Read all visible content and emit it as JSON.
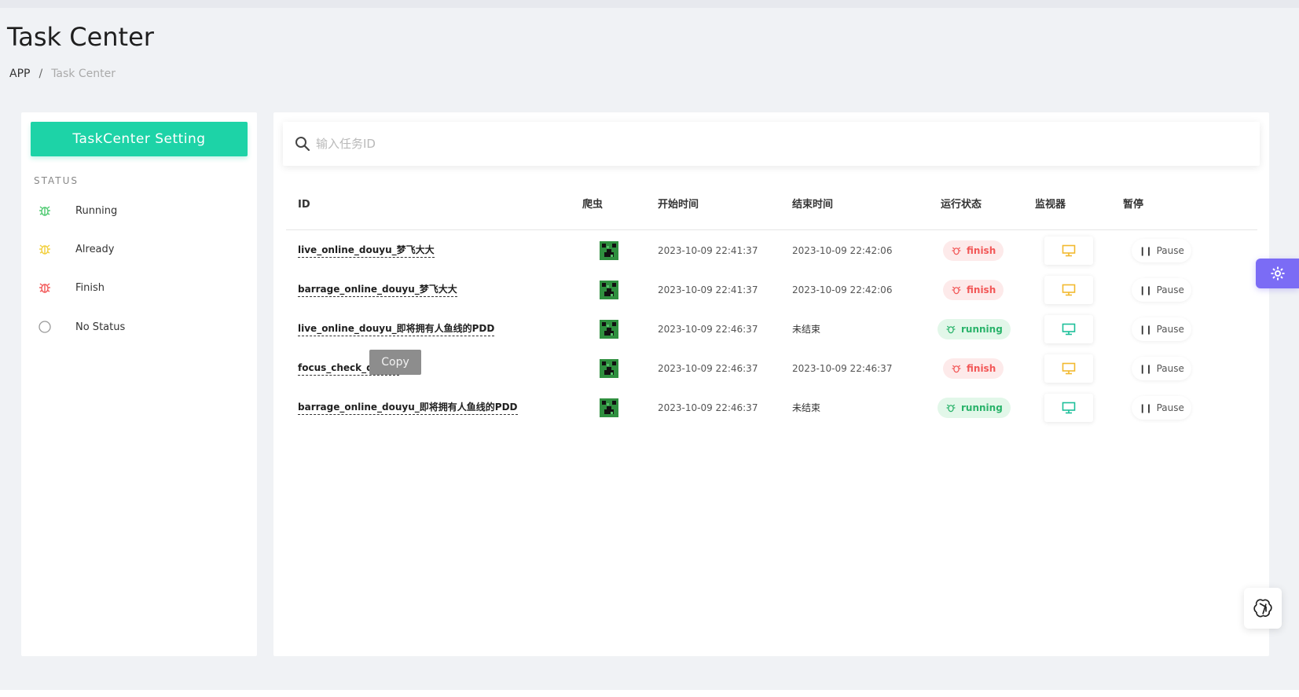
{
  "page": {
    "title": "Task Center",
    "breadcrumb": {
      "root": "APP",
      "separator": "/",
      "current": "Task Center"
    }
  },
  "sidebar": {
    "setting_button": "TaskCenter Setting",
    "status_heading": "STATUS",
    "items": [
      {
        "label": "Running",
        "icon": "bug-icon",
        "color": "#4cc96f"
      },
      {
        "label": "Already",
        "icon": "bug-icon",
        "color": "#f2cf3b"
      },
      {
        "label": "Finish",
        "icon": "bug-icon",
        "color": "#f25757"
      },
      {
        "label": "No Status",
        "icon": "circle-icon",
        "color": "#999999"
      }
    ]
  },
  "search": {
    "placeholder": "输入任务ID",
    "value": ""
  },
  "table": {
    "columns": [
      "ID",
      "爬虫",
      "开始时间",
      "结束时间",
      "运行状态",
      "监视器",
      "暂停"
    ],
    "rows": [
      {
        "id": "live_online_douyu_梦飞大大",
        "start": "2023-10-09 22:41:37",
        "end": "2023-10-09 22:42:06",
        "status": "finish",
        "monitor_color": "#f2b92e",
        "pause": "Pause"
      },
      {
        "id": "barrage_online_douyu_梦飞大大",
        "start": "2023-10-09 22:41:37",
        "end": "2023-10-09 22:42:06",
        "status": "finish",
        "monitor_color": "#f2b92e",
        "pause": "Pause"
      },
      {
        "id": "live_online_douyu_即将拥有人鱼线的PDD",
        "start": "2023-10-09 22:46:37",
        "end": "未结束",
        "status": "running",
        "monitor_color": "#1dbf9a",
        "pause": "Pause"
      },
      {
        "id": "focus_check_douyu",
        "start": "2023-10-09 22:46:37",
        "end": "2023-10-09 22:46:37",
        "status": "finish",
        "monitor_color": "#f2b92e",
        "pause": "Pause"
      },
      {
        "id": "barrage_online_douyu_即将拥有人鱼线的PDD",
        "start": "2023-10-09 22:46:37",
        "end": "未结束",
        "status": "running",
        "monitor_color": "#1dbf9a",
        "pause": "Pause"
      }
    ]
  },
  "tooltip": {
    "copy": "Copy"
  },
  "colors": {
    "accent": "#1dd3a7",
    "finish": "#f25757",
    "running": "#29b36a",
    "float_button": "#7b6cf5"
  }
}
